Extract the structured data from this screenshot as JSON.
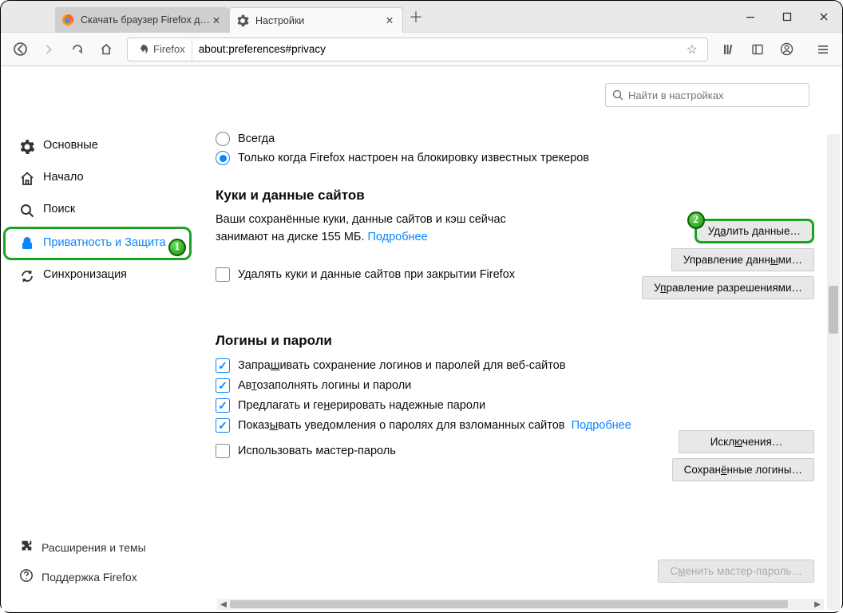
{
  "tabs": {
    "t0": {
      "label": "Скачать браузер Firefox для ко"
    },
    "t1": {
      "label": "Настройки"
    }
  },
  "identity": {
    "brand": "Firefox"
  },
  "url": "about:preferences#privacy",
  "search": {
    "placeholder": "Найти в настройках"
  },
  "sidebar": {
    "general": "Основные",
    "home": "Начало",
    "search": "Поиск",
    "privacy": "Приватность и Защита",
    "sync": "Синхронизация"
  },
  "sidebar_footer": {
    "ext": "Расширения и темы",
    "support": "Поддержка Firefox"
  },
  "marker1": "1",
  "marker2": "2",
  "dnt": {
    "always": "Всегда",
    "only_pre": "Только когда Firefox настроен на блокировку известных трекеров"
  },
  "cookies": {
    "heading": "Куки и данные сайтов",
    "desc_pre": "Ваши сохранённые куки, данные сайтов и кэш сейчас занимают на диске ",
    "size": "155 МБ",
    "desc_post": ".   ",
    "learn_more": "Подробнее",
    "delete_on_close": "Удалять куки и данные сайтов при закрытии Firefox",
    "btn_clear_pre": "Уд",
    "btn_clear_ak": "а",
    "btn_clear_post": "лить данные…",
    "btn_manage_pre": "Управление данн",
    "btn_manage_ak": "ы",
    "btn_manage_post": "ми…",
    "btn_perm_pre": "У",
    "btn_perm_ak": "п",
    "btn_perm_post": "равление разрешениями…"
  },
  "logins": {
    "heading": "Логины и пароли",
    "ask_pre": "Запра",
    "ask_ak": "ш",
    "ask_post": "ивать сохранение логинов и паролей для веб-сайтов",
    "autofill_pre": "Ав",
    "autofill_ak": "т",
    "autofill_post": "озаполнять логины и пароли",
    "suggest_pre": "Предлагать и ге",
    "suggest_ak": "н",
    "suggest_post": "ерировать надежные пароли",
    "breach_pre": "Показ",
    "breach_ak": "ы",
    "breach_post": "вать уведомления о паролях для взломанных сайтов",
    "breach_more": "Подробнее",
    "master": "Использовать мастер-пароль",
    "btn_exc_pre": "Искл",
    "btn_exc_ak": "ю",
    "btn_exc_post": "чения…",
    "btn_saved_pre": "Сохран",
    "btn_saved_ak": "ё",
    "btn_saved_post": "нные логины…",
    "btn_change_pre": "С",
    "btn_change_ak": "м",
    "btn_change_post": "енить мастер-пароль…"
  }
}
